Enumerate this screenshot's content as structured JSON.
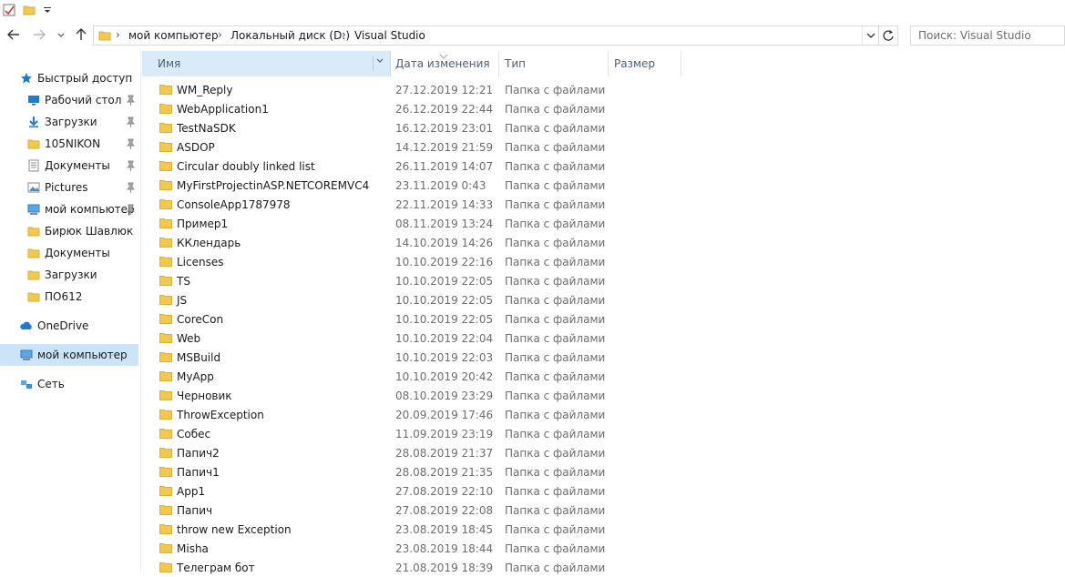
{
  "address": {
    "crumbs": [
      "мой компьютер",
      "Локальный диск (D:)",
      "Visual Studio"
    ]
  },
  "search": {
    "placeholder": "Поиск: Visual Studio"
  },
  "sidebar": {
    "items": [
      {
        "label": "Быстрый доступ",
        "icon": "star-icon",
        "pinned": false
      },
      {
        "label": "Рабочий стол",
        "icon": "desktop-icon",
        "pinned": true
      },
      {
        "label": "Загрузки",
        "icon": "download-icon",
        "pinned": true
      },
      {
        "label": "105NIKON",
        "icon": "folder-icon",
        "pinned": true
      },
      {
        "label": "Документы",
        "icon": "documents-icon",
        "pinned": true
      },
      {
        "label": "Pictures",
        "icon": "pictures-icon",
        "pinned": true
      },
      {
        "label": "мой компьютер",
        "icon": "computer-icon",
        "pinned": true
      },
      {
        "label": "Бирюк Шавлюк",
        "icon": "folder-icon",
        "pinned": false
      },
      {
        "label": "Документы",
        "icon": "folder-icon",
        "pinned": false
      },
      {
        "label": "Загрузки",
        "icon": "folder-icon",
        "pinned": false
      },
      {
        "label": "ПО612",
        "icon": "folder-icon",
        "pinned": false
      },
      {
        "label": "OneDrive",
        "icon": "cloud-icon",
        "pinned": false
      },
      {
        "label": "мой компьютер",
        "icon": "computer-icon",
        "pinned": false
      },
      {
        "label": "Сеть",
        "icon": "network-icon",
        "pinned": false
      }
    ]
  },
  "columns": {
    "name": "Имя",
    "date": "Дата изменения",
    "type": "Тип",
    "size": "Размер"
  },
  "files": [
    {
      "name": "WM_Reply",
      "date": "27.12.2019 12:21",
      "type": "Папка с файлами"
    },
    {
      "name": "WebApplication1",
      "date": "26.12.2019 22:44",
      "type": "Папка с файлами"
    },
    {
      "name": "TestNaSDK",
      "date": "16.12.2019 23:01",
      "type": "Папка с файлами"
    },
    {
      "name": "ASDOP",
      "date": "14.12.2019 21:59",
      "type": "Папка с файлами"
    },
    {
      "name": "Circular doubly linked list",
      "date": "26.11.2019 14:07",
      "type": "Папка с файлами"
    },
    {
      "name": "MyFirstProjectinASP.NETCOREMVC4",
      "date": "23.11.2019 0:43",
      "type": "Папка с файлами"
    },
    {
      "name": "ConsoleApp1787978",
      "date": "22.11.2019 14:33",
      "type": "Папка с файлами"
    },
    {
      "name": "Пример1",
      "date": "08.11.2019 13:24",
      "type": "Папка с файлами"
    },
    {
      "name": "ККлендарь",
      "date": "14.10.2019 14:26",
      "type": "Папка с файлами"
    },
    {
      "name": "Licenses",
      "date": "10.10.2019 22:16",
      "type": "Папка с файлами"
    },
    {
      "name": "TS",
      "date": "10.10.2019 22:05",
      "type": "Папка с файлами"
    },
    {
      "name": "JS",
      "date": "10.10.2019 22:05",
      "type": "Папка с файлами"
    },
    {
      "name": "CoreCon",
      "date": "10.10.2019 22:05",
      "type": "Папка с файлами"
    },
    {
      "name": "Web",
      "date": "10.10.2019 22:04",
      "type": "Папка с файлами"
    },
    {
      "name": "MSBuild",
      "date": "10.10.2019 22:03",
      "type": "Папка с файлами"
    },
    {
      "name": "MyApp",
      "date": "10.10.2019 20:42",
      "type": "Папка с файлами"
    },
    {
      "name": "Черновик",
      "date": "08.10.2019 23:29",
      "type": "Папка с файлами"
    },
    {
      "name": "ThrowException",
      "date": "20.09.2019 17:46",
      "type": "Папка с файлами"
    },
    {
      "name": "Собес",
      "date": "11.09.2019 23:19",
      "type": "Папка с файлами"
    },
    {
      "name": "Папич2",
      "date": "28.08.2019 21:37",
      "type": "Папка с файлами"
    },
    {
      "name": "Папич1",
      "date": "28.08.2019 21:35",
      "type": "Папка с файлами"
    },
    {
      "name": "App1",
      "date": "27.08.2019 22:10",
      "type": "Папка с файлами"
    },
    {
      "name": "Папич",
      "date": "27.08.2019 22:08",
      "type": "Папка с файлами"
    },
    {
      "name": "throw new Exception",
      "date": "23.08.2019 18:45",
      "type": "Папка с файлами"
    },
    {
      "name": "Misha",
      "date": "23.08.2019 18:44",
      "type": "Папка с файлами"
    },
    {
      "name": "Телеграм бот",
      "date": "21.08.2019 18:39",
      "type": "Папка с файлами"
    }
  ],
  "colors": {
    "folder": "#f2c94c",
    "folder_dark": "#dcae35",
    "selection": "#cce4f7",
    "header_selected": "#d9ebf9",
    "accent": "#0063b1"
  }
}
